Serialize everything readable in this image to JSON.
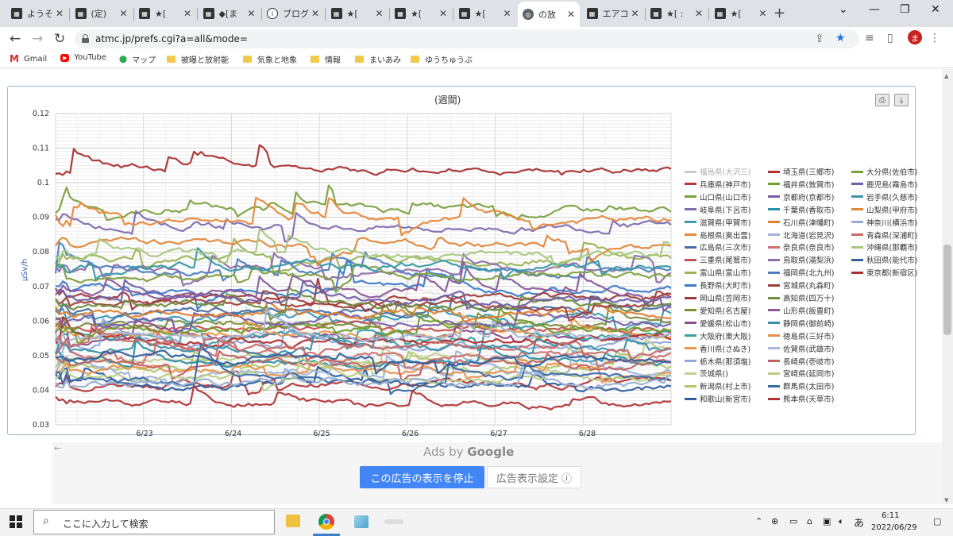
{
  "tabs": [
    {
      "title": "ようそ",
      "icon": "site-icon"
    },
    {
      "title": "(定)",
      "icon": "site-icon"
    },
    {
      "title": "★[",
      "icon": "site-icon"
    },
    {
      "title": "◆[ま",
      "icon": "site-icon"
    },
    {
      "title": "ブログ",
      "icon": "info-icon"
    },
    {
      "title": "★[",
      "icon": "site-icon"
    },
    {
      "title": "★[",
      "icon": "site-icon"
    },
    {
      "title": "★[",
      "icon": "site-icon"
    },
    {
      "title": "の放",
      "icon": "globe-icon"
    },
    {
      "title": "エアコ",
      "icon": "site-icon"
    },
    {
      "title": "★[ :",
      "icon": "site-icon"
    },
    {
      "title": "★[",
      "icon": "site-icon"
    }
  ],
  "url": "atmc.jp/prefs.cgi?a=all&mode=",
  "avatar_letter": "ま",
  "bookmarks": [
    {
      "label": "Gmail",
      "icon": "gmail-icon"
    },
    {
      "label": "YouTube",
      "icon": "youtube-icon"
    },
    {
      "label": "マップ",
      "icon": "maps-icon"
    },
    {
      "label": "被曝と放射能",
      "icon": "folder-icon"
    },
    {
      "label": "気象と地象",
      "icon": "folder-icon"
    },
    {
      "label": "情報",
      "icon": "folder-icon"
    },
    {
      "label": "まいあみ",
      "icon": "folder-icon"
    },
    {
      "label": "ゆうちゅうぶ",
      "icon": "folder-icon"
    }
  ],
  "chart_data": {
    "type": "line",
    "title": "(週間)",
    "ylabel": "μSv/h",
    "xlabel": "",
    "ylim": [
      0.03,
      0.12
    ],
    "yticks": [
      "0.12",
      "0.11",
      "0.1",
      "0.09",
      "0.08",
      "0.07",
      "0.06",
      "0.05",
      "0.04",
      "0.03"
    ],
    "xticks": [
      "6/23",
      "6/24",
      "6/25",
      "6/26",
      "6/27",
      "6/28"
    ],
    "grid": true,
    "legend_position": "right",
    "series": [
      {
        "name": "福島県(大沢三)",
        "color": "#c8c8c8",
        "base": 0.066
      },
      {
        "name": "兵庫県(神戸市)",
        "color": "#b5383a",
        "base": 0.042
      },
      {
        "name": "山口県(山口市)",
        "color": "#7ba23f",
        "base": 0.092
      },
      {
        "name": "岐阜県(下呂市)",
        "color": "#7f6bb0",
        "base": 0.087
      },
      {
        "name": "滋賀県(甲賀市)",
        "color": "#3a9bb5",
        "base": 0.061
      },
      {
        "name": "島根県(奥出雲)",
        "color": "#e8883a",
        "base": 0.089
      },
      {
        "name": "広島県(三次市)",
        "color": "#4a6fa5",
        "base": 0.063
      },
      {
        "name": "三重県(尾鷲市)",
        "color": "#c94f4f",
        "base": 0.058
      },
      {
        "name": "富山県(富山市)",
        "color": "#9ab556",
        "base": 0.078
      },
      {
        "name": "長野県(大町市)",
        "color": "#3d7cc9",
        "base": 0.069
      },
      {
        "name": "岡山県(笠岡市)",
        "color": "#a03a3a",
        "base": 0.067
      },
      {
        "name": "愛知県(名古屋)",
        "color": "#7a8f3a",
        "base": 0.059
      },
      {
        "name": "愛媛県(松山市)",
        "color": "#8c4f8c",
        "base": 0.056
      },
      {
        "name": "大阪府(東大阪)",
        "color": "#3aa0a0",
        "base": 0.056
      },
      {
        "name": "香川県(さぬき)",
        "color": "#e89a4a",
        "base": 0.056
      },
      {
        "name": "栃木県(那須塩)",
        "color": "#8fa8d8",
        "base": 0.053
      },
      {
        "name": "茨城県()",
        "color": "#c0d090",
        "base": 0.049
      },
      {
        "name": "新潟県(村上市)",
        "color": "#b0c870",
        "base": 0.047
      },
      {
        "name": "和歌山(新宮市)",
        "color": "#2f5f9f",
        "base": 0.041
      },
      {
        "name": "埼玉県(三郷市)",
        "color": "#b23030",
        "base": 0.054
      },
      {
        "name": "福井県(敦賀市)",
        "color": "#6f9f2f",
        "base": 0.058
      },
      {
        "name": "京都府(京都市)",
        "color": "#7a5fa8",
        "base": 0.06
      },
      {
        "name": "千葉県(香取市)",
        "color": "#2f8fa8",
        "base": 0.048
      },
      {
        "name": "石川県(津幡町)",
        "color": "#e07f2f",
        "base": 0.062
      },
      {
        "name": "北海道(岩見沢)",
        "color": "#9fb3d8",
        "base": 0.045
      },
      {
        "name": "奈良県(奈良市)",
        "color": "#d07070",
        "base": 0.05
      },
      {
        "name": "鳥取県(湯梨浜)",
        "color": "#8f6fa8",
        "base": 0.075
      },
      {
        "name": "福岡県(北九州)",
        "color": "#4f7fbf",
        "base": 0.074
      },
      {
        "name": "宮城県(丸森町)",
        "color": "#a04040",
        "base": 0.065
      },
      {
        "name": "高知県(四万十)",
        "color": "#6f8f3f",
        "base": 0.064
      },
      {
        "name": "山形県(飯豊町)",
        "color": "#8a5a9a",
        "base": 0.068
      },
      {
        "name": "静岡県(御前崎)",
        "color": "#3a90a8",
        "base": 0.052
      },
      {
        "name": "徳島県(三好市)",
        "color": "#e8904a",
        "base": 0.046
      },
      {
        "name": "佐賀県(武雄市)",
        "color": "#a8b8d8",
        "base": 0.055
      },
      {
        "name": "長崎県(壱岐市)",
        "color": "#c06060",
        "base": 0.048
      },
      {
        "name": "宮崎県(延岡市)",
        "color": "#b8cc88",
        "base": 0.044
      },
      {
        "name": "群馬県(太田市)",
        "color": "#3a6aa8",
        "base": 0.043
      },
      {
        "name": "熊本県(天草市)",
        "color": "#b03535",
        "base": 0.036
      },
      {
        "name": "大分県(佐伯市)",
        "color": "#7fa040",
        "base": 0.073
      },
      {
        "name": "鹿児島(霧島市)",
        "color": "#7060a8",
        "base": 0.066
      },
      {
        "name": "岩手県(久慈市)",
        "color": "#3898a8",
        "base": 0.076
      },
      {
        "name": "山梨県(甲府市)",
        "color": "#e0883a",
        "base": 0.082
      },
      {
        "name": "神奈川(横浜市)",
        "color": "#98b0d0",
        "base": 0.042
      },
      {
        "name": "青森県(深浦町)",
        "color": "#c86a6a",
        "base": 0.053
      },
      {
        "name": "沖縄県(那覇市)",
        "color": "#a8c880",
        "base": 0.079
      },
      {
        "name": "秋田県(能代市)",
        "color": "#3060a0",
        "base": 0.049
      },
      {
        "name": "東京都(新宿区)",
        "color": "#a83030",
        "base": 0.104
      }
    ]
  },
  "ads": {
    "ads_by": "Ads by",
    "google": "Google",
    "stop_label": "この広告の表示を停止",
    "settings_label": "広告表示設定 ⓘ"
  },
  "taskbar": {
    "search_placeholder": "ここに入力して検索",
    "time": "6:11",
    "date": "2022/06/29",
    "ime": "あ"
  }
}
